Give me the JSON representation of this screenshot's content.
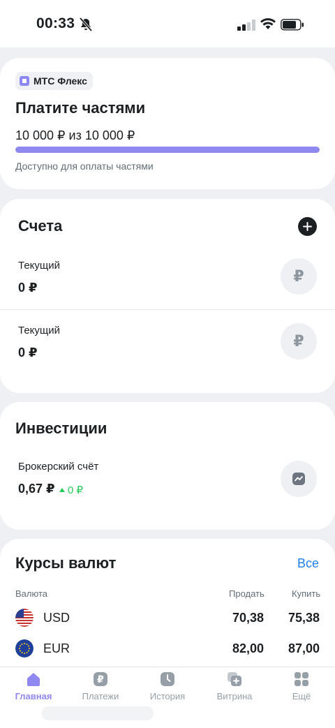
{
  "status_bar": {
    "time": "00:33",
    "icons": [
      "bell-off-icon",
      "signal-icon",
      "wifi-icon",
      "battery-icon"
    ]
  },
  "mts_flex": {
    "badge": "МТС Флекс",
    "title": "Платите частями",
    "amount": "10 000 ₽ из 10 000 ₽",
    "progress": 1.0,
    "caption": "Доступно для оплаты частями"
  },
  "accounts": {
    "title": "Счета",
    "items": [
      {
        "label": "Текущий",
        "amount": "0 ₽",
        "icon": "₽"
      },
      {
        "label": "Текущий",
        "amount": "0 ₽",
        "icon": "₽"
      }
    ]
  },
  "investments": {
    "title": "Инвестиции",
    "broker_label": "Брокерский счёт",
    "broker_amount": "0,67 ₽",
    "broker_change": "0 ₽"
  },
  "rates": {
    "title": "Курсы валют",
    "all_link": "Все",
    "headers": {
      "currency": "Валюта",
      "sell": "Продать",
      "buy": "Купить"
    },
    "rows": [
      {
        "code": "USD",
        "sell": "70,38",
        "buy": "75,38"
      },
      {
        "code": "EUR",
        "sell": "82,00",
        "buy": "87,00"
      }
    ]
  },
  "tabbar": [
    {
      "label": "Главная",
      "icon": "home-icon",
      "active": true
    },
    {
      "label": "Платежи",
      "icon": "payments-icon",
      "active": false
    },
    {
      "label": "История",
      "icon": "history-icon",
      "active": false
    },
    {
      "label": "Витрина",
      "icon": "showcase-icon",
      "active": false
    },
    {
      "label": "Ещё",
      "icon": "more-icon",
      "active": false
    }
  ],
  "colors": {
    "accent": "#8f88f1",
    "link": "#1d7ff0",
    "positive": "#26cd58",
    "text": "#1d2023",
    "secondary": "#626c77"
  }
}
